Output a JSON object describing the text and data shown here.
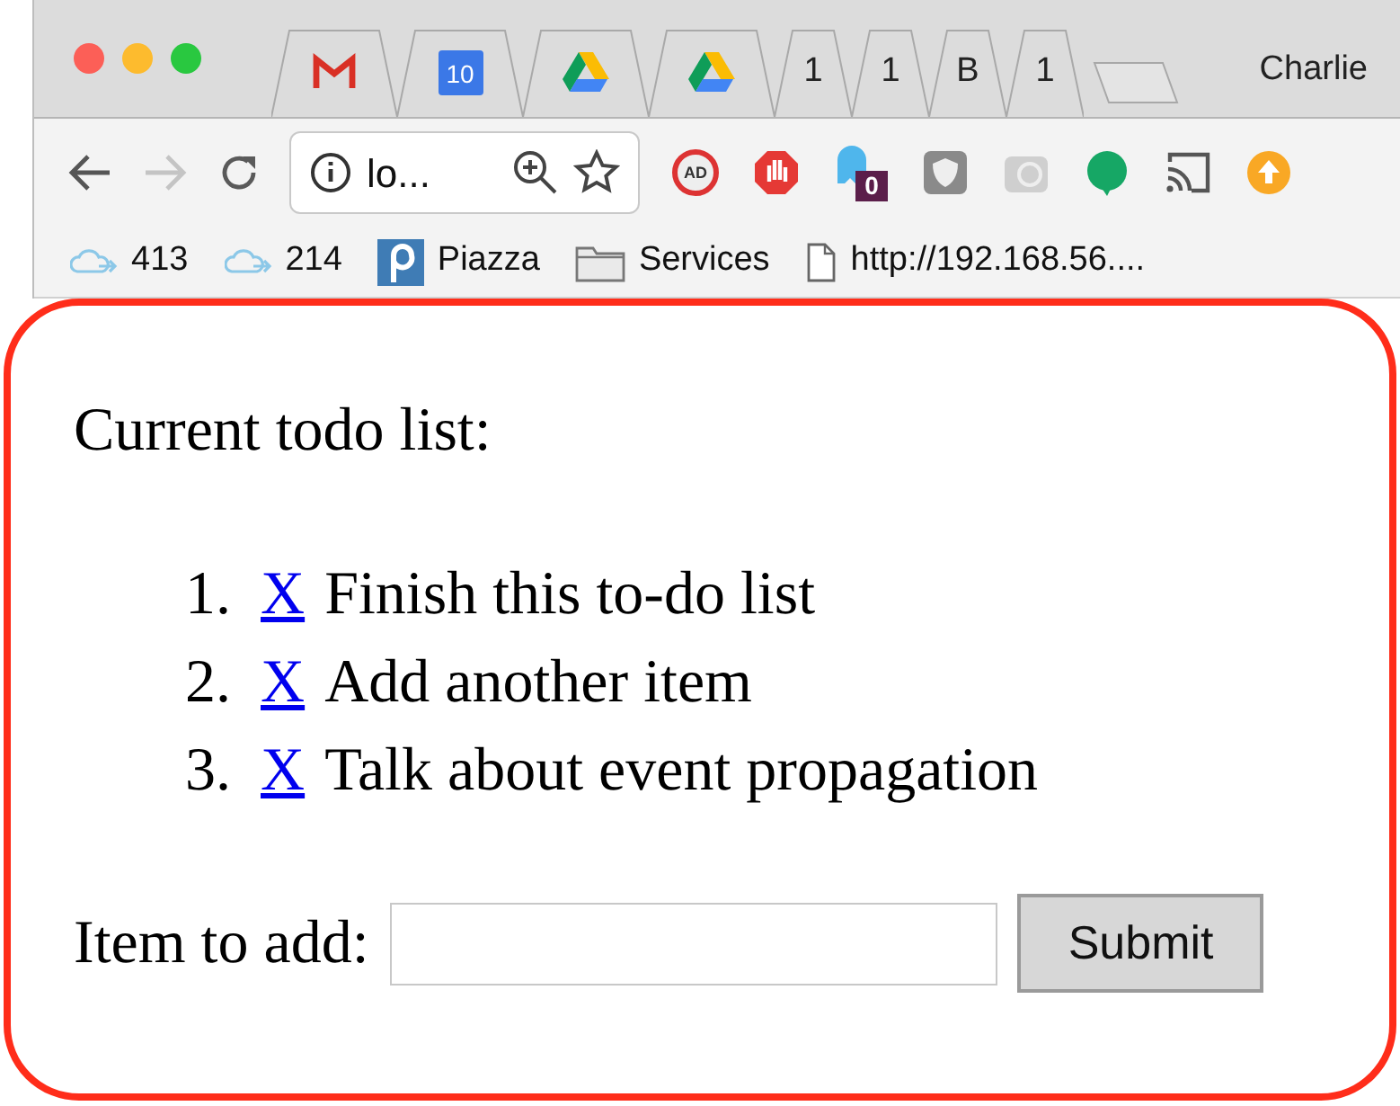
{
  "window": {
    "profile": "Charlie"
  },
  "tabs": [
    {
      "kind": "gmail"
    },
    {
      "kind": "calendar",
      "icon_text": "10"
    },
    {
      "kind": "drive"
    },
    {
      "kind": "drive"
    },
    {
      "kind": "text",
      "label": "1"
    },
    {
      "kind": "text",
      "label": "1"
    },
    {
      "kind": "text",
      "label": "B"
    },
    {
      "kind": "text",
      "label": "1"
    },
    {
      "kind": "new"
    }
  ],
  "toolbar": {
    "back": {
      "disabled": false
    },
    "forward": {
      "disabled": true
    },
    "address": "lo..."
  },
  "extensions": [
    {
      "kind": "adblock",
      "icon_text": "AD"
    },
    {
      "kind": "hand"
    },
    {
      "kind": "ghost",
      "badge": "0"
    },
    {
      "kind": "shield"
    },
    {
      "kind": "grammar"
    },
    {
      "kind": "chat"
    },
    {
      "kind": "cast"
    },
    {
      "kind": "update"
    }
  ],
  "bookmarks": [
    {
      "kind": "cloud",
      "label": "413"
    },
    {
      "kind": "cloud",
      "label": "214"
    },
    {
      "kind": "piazza",
      "label": "Piazza"
    },
    {
      "kind": "folder",
      "label": "Services"
    },
    {
      "kind": "page",
      "label": "http://192.168.56...."
    }
  ],
  "content": {
    "heading": "Current todo list:",
    "items": [
      {
        "number": "1.",
        "remove": "X",
        "text": "Finish this to-do list"
      },
      {
        "number": "2.",
        "remove": "X",
        "text": "Add another item"
      },
      {
        "number": "3.",
        "remove": "X",
        "text": "Talk about event propagation"
      }
    ],
    "form": {
      "label": "Item to add:",
      "button": "Submit"
    }
  }
}
